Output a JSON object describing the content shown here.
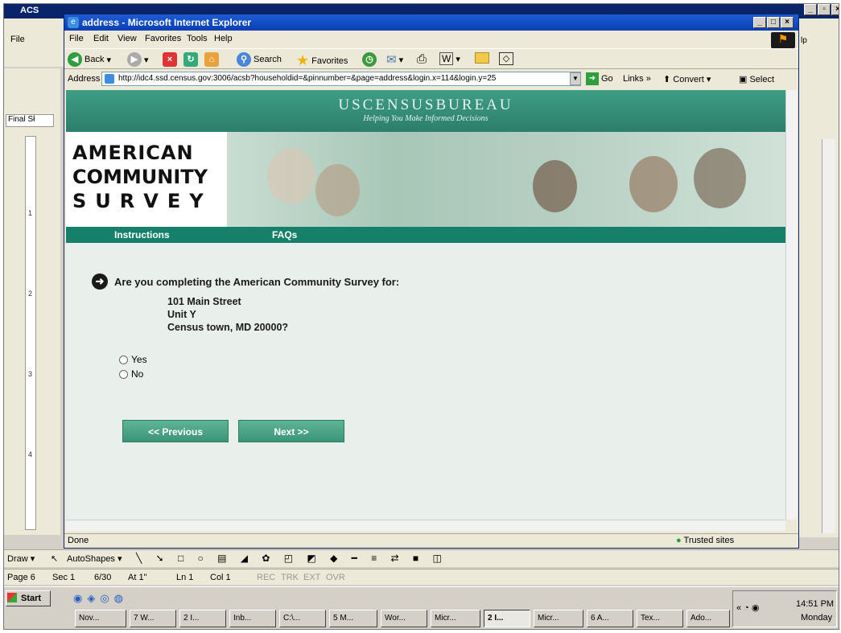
{
  "word": {
    "title": "ACS",
    "menu_file": "File",
    "help_fragment": "lp",
    "final_label": "Final Sł",
    "ruler_marks": [
      "1",
      "2",
      "3",
      "4"
    ],
    "draw_bar": {
      "draw": "Draw",
      "autoshapes": "AutoShapes"
    },
    "status": {
      "page": "Page 6",
      "sec": "Sec 1",
      "pages": "6/30",
      "at": "At 1\"",
      "ln": "Ln 1",
      "col": "Col 1",
      "rec": "REC",
      "trk": "TRK",
      "ext": "EXT",
      "ovr": "OVR"
    }
  },
  "ie": {
    "title": "address - Microsoft Internet Explorer",
    "menu": [
      "File",
      "Edit",
      "View",
      "Favorites",
      "Tools",
      "Help"
    ],
    "toolbar": {
      "back": "Back",
      "search": "Search",
      "favorites": "Favorites"
    },
    "address_label": "Address",
    "url": "http://idc4.ssd.census.gov:3006/acsb?householdid=&pinnumber=&page=address&login.x=114&login.y=25",
    "go": "Go",
    "links": "Links",
    "convert": "Convert",
    "select": "Select",
    "status_text": "Done",
    "zone": "Trusted sites"
  },
  "page": {
    "bureau": "USCENSUSBUREAU",
    "tagline": "Helping You Make Informed Decisions",
    "logo_lines": [
      "AMERICAN",
      "COMMUNITY",
      "SURVEY"
    ],
    "nav": [
      "Instructions",
      "FAQs"
    ],
    "question": "Are you completing the American Community Survey for:",
    "address": [
      "101 Main Street",
      "Unit Y",
      "Census town, MD 20000?"
    ],
    "options": [
      "Yes",
      "No"
    ],
    "prev_label": "<<   Previous",
    "next_label": "Next   >>"
  },
  "taskbar": {
    "start": "Start",
    "tasks": [
      "Nov...",
      "7 W...",
      "2 I...",
      "Inb...",
      "C:\\...",
      "5 M...",
      "Wor...",
      "Micr...",
      "2 I...",
      "Micr...",
      "6 A...",
      "Tex...",
      "Ado..."
    ],
    "time": "14:51 PM",
    "day": "Monday"
  }
}
